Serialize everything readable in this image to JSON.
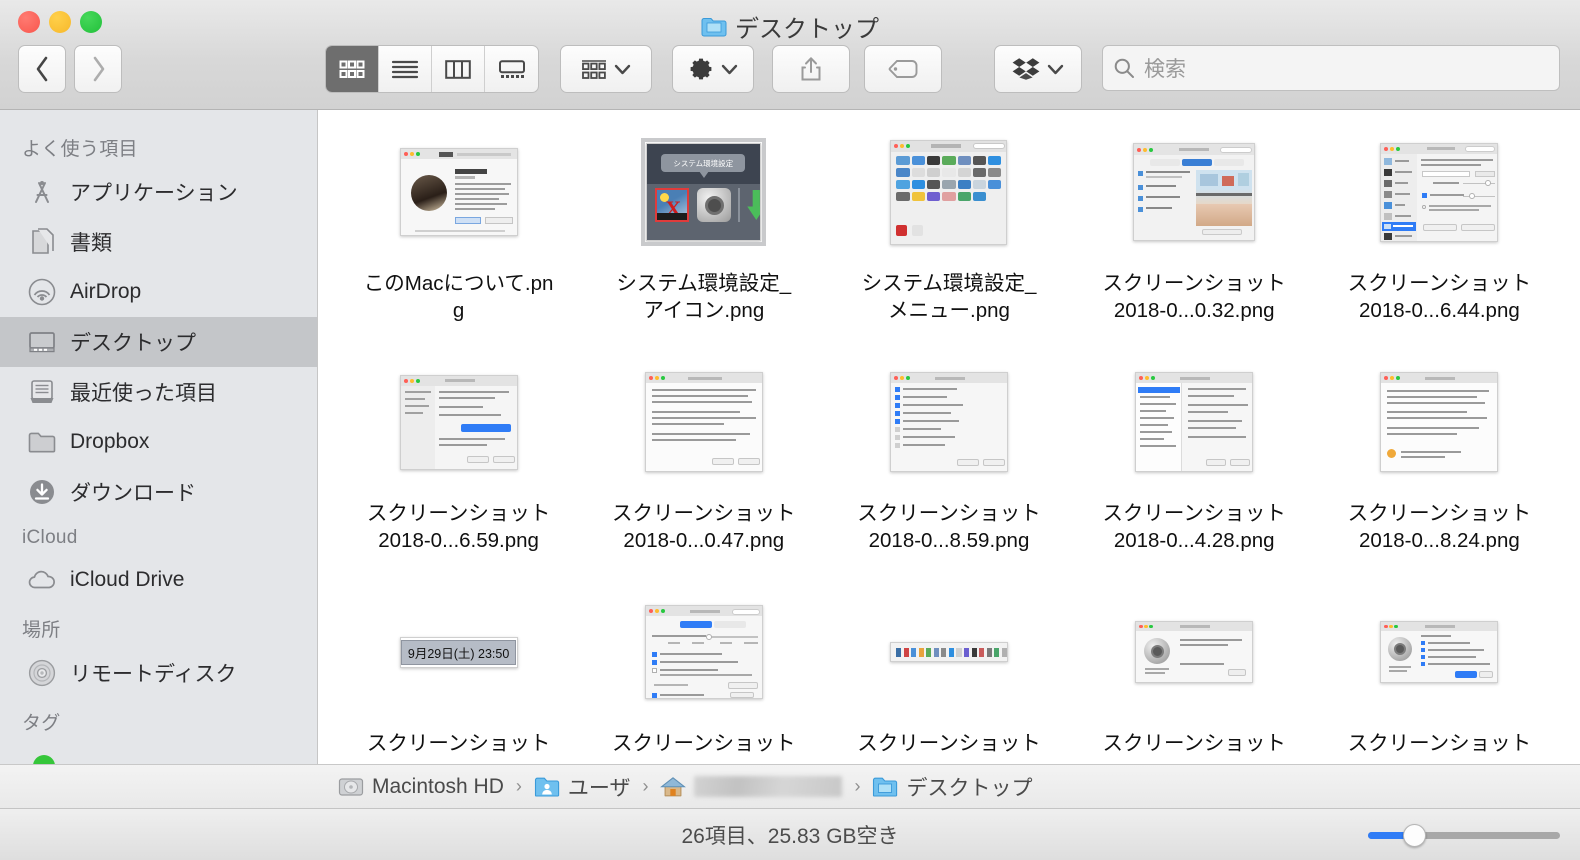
{
  "window": {
    "title": "デスクトップ",
    "title_icon": "folder-icon",
    "traffic_lights": [
      "close-button",
      "minimize-button",
      "zoom-button"
    ]
  },
  "toolbar": {
    "back_label": "戻る",
    "forward_label": "進む",
    "view_modes": [
      {
        "name": "icon-view",
        "icon": "grid-icon",
        "active": true
      },
      {
        "name": "list-view",
        "icon": "list-icon",
        "active": false
      },
      {
        "name": "column-view",
        "icon": "columns-icon",
        "active": false
      },
      {
        "name": "gallery-view",
        "icon": "gallery-icon",
        "active": false
      }
    ],
    "arrange_label": "",
    "arrange_icon": "arrange-icon",
    "action_icon": "gear-icon",
    "share_icon": "share-icon",
    "tag_icon": "tag-icon",
    "dropbox_icon": "dropbox-icon"
  },
  "search": {
    "placeholder": "検索",
    "value": "",
    "icon": "search-icon"
  },
  "sidebar": {
    "sections": [
      {
        "header": "よく使う項目",
        "items": [
          {
            "label": "アプリケーション",
            "icon": "applications-icon",
            "selected": false
          },
          {
            "label": "書類",
            "icon": "documents-icon",
            "selected": false
          },
          {
            "label": "AirDrop",
            "icon": "airdrop-icon",
            "selected": false
          },
          {
            "label": "デスクトップ",
            "icon": "desktop-icon",
            "selected": true
          },
          {
            "label": "最近使った項目",
            "icon": "recents-icon",
            "selected": false
          },
          {
            "label": "Dropbox",
            "icon": "folder-icon",
            "selected": false
          },
          {
            "label": "ダウンロード",
            "icon": "downloads-icon",
            "selected": false
          }
        ]
      },
      {
        "header": "iCloud",
        "items": [
          {
            "label": "iCloud Drive",
            "icon": "cloud-icon",
            "selected": false
          }
        ]
      },
      {
        "header": "場所",
        "items": [
          {
            "label": "リモートディスク",
            "icon": "disc-icon",
            "selected": false
          }
        ]
      },
      {
        "header": "タグ",
        "items": [
          {
            "label": "",
            "icon": "green-tag-icon",
            "selected": false
          }
        ]
      }
    ]
  },
  "files": [
    {
      "name": "このMacについて.png",
      "thumb": "about-this-mac",
      "selected": false
    },
    {
      "name": "システム環境設定_アイコン.png",
      "thumb": "dock-tooltip",
      "selected": true
    },
    {
      "name": "システム環境設定_メニュー.png",
      "thumb": "sys-prefs-grid",
      "selected": false
    },
    {
      "name": "スクリーンショット 2018-0...0.32.png",
      "thumb": "prefs-desktop",
      "selected": false
    },
    {
      "name": "スクリーンショット 2018-0...6.44.png",
      "thumb": "prefs-list",
      "selected": false
    },
    {
      "name": "スクリーンショット 2018-0...6.59.png",
      "thumb": "prefs-form",
      "selected": false
    },
    {
      "name": "スクリーンショット 2018-0...0.47.png",
      "thumb": "doc-window",
      "selected": false
    },
    {
      "name": "スクリーンショット 2018-0...8.59.png",
      "thumb": "prefs-checklist",
      "selected": false
    },
    {
      "name": "スクリーンショット 2018-0...4.28.png",
      "thumb": "prefs-sidebar-list",
      "selected": false
    },
    {
      "name": "スクリーンショット 2018-0...8.24.png",
      "thumb": "plain-doc",
      "selected": false
    },
    {
      "name": "スクリーンショット",
      "thumb": "clock-badge",
      "selected": false,
      "badge_text": "9月29日(土)  23:50"
    },
    {
      "name": "スクリーンショット",
      "thumb": "prefs-wide",
      "selected": false
    },
    {
      "name": "スクリーンショット",
      "thumb": "menubar-strip",
      "selected": false
    },
    {
      "name": "スクリーンショット",
      "thumb": "alert-dialog",
      "selected": false
    },
    {
      "name": "スクリーンショット",
      "thumb": "alert-dialog-2",
      "selected": false
    }
  ],
  "pathbar": {
    "crumbs": [
      {
        "label": "Macintosh HD",
        "icon": "harddisk-icon"
      },
      {
        "label": "ユーザ",
        "icon": "users-folder-icon"
      },
      {
        "label": "",
        "icon": "home-icon",
        "blurred": true
      },
      {
        "label": "デスクトップ",
        "icon": "folder-icon"
      }
    ],
    "separator": "›"
  },
  "statusbar": {
    "text": "26項目、25.83 GB空き",
    "zoom_icon": "zoom-slider",
    "zoom_value": 25
  },
  "colors": {
    "accent": "#2f7cf6",
    "sidebar_bg": "#e4e6e9",
    "selection": "#c4c6c9",
    "tag_green": "#35c63a"
  }
}
